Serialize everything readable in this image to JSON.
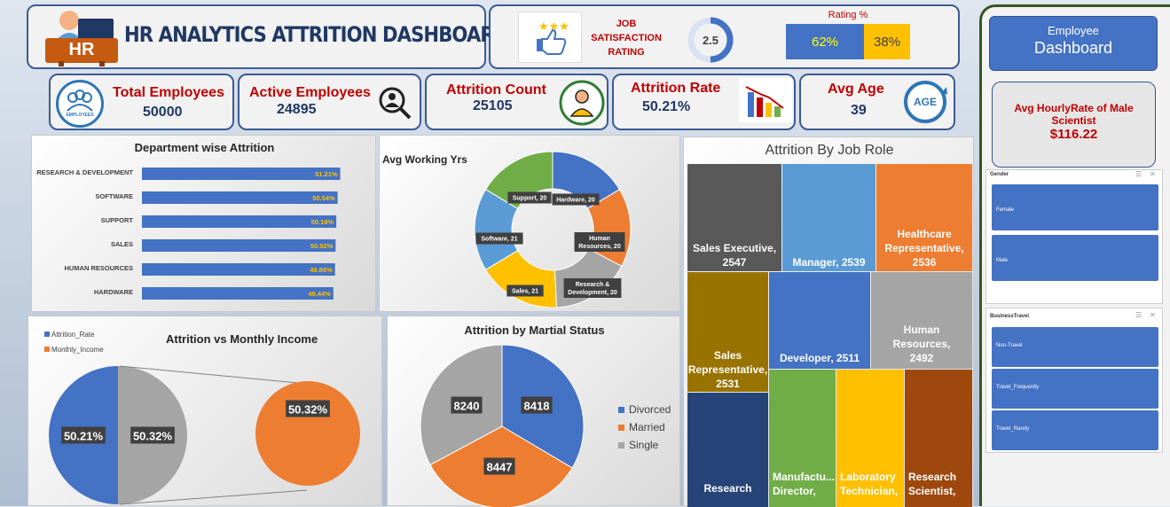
{
  "header": {
    "title": "HR ANALYTICS ATTRITION DASHBOARD",
    "logo_text": "HR"
  },
  "satisfaction": {
    "label_line1": "JOB",
    "label_line2": "SATISFACTION",
    "label_line3": "RATING",
    "value": "2.5",
    "gauge_fraction": 0.5
  },
  "rating": {
    "title": "Rating %",
    "seg1": "62%",
    "seg2": "38%",
    "seg1_fraction": 0.62,
    "seg1_color": "#4472c4",
    "seg2_color": "#ffc000"
  },
  "kpis": {
    "total_label": "Total Employees",
    "total_value": "50000",
    "total_icon_text": "EMPLOYEES",
    "active_label": "Active Employees",
    "active_value": "24895",
    "count_label": "Attrition Count",
    "count_value": "25105",
    "rate_label": "Attrition Rate",
    "rate_value": "50.21%",
    "age_label": "Avg Age",
    "age_value": "39",
    "age_icon_text": "AGE"
  },
  "sidebar": {
    "btn_line1": "Employee",
    "btn_line2": "Dashboard",
    "hourly_label": "Avg HourlyRate of Male Scientist",
    "hourly_value": "$116.22",
    "gender_title": "Gender",
    "gender_items": [
      "Female",
      "Male"
    ],
    "travel_title": "BusinessTravel",
    "travel_items": [
      "Non-Travel",
      "Travel_Frequently",
      "Travel_Rarely"
    ]
  },
  "dept_chart": {
    "title": "Department wise Attrition"
  },
  "avg_chart": {
    "title": "Avg Working Yrs"
  },
  "income_chart": {
    "title": "Attrition vs Monthly Income",
    "legend": [
      "Attrition_Rate",
      "Monthly_Income"
    ]
  },
  "marital_chart": {
    "title": "Attrition by Martial Status",
    "legend": [
      "Divorced",
      "Married",
      "Single"
    ]
  },
  "role_chart": {
    "title": "Attrition By Job Role"
  },
  "colors": {
    "blue": "#4472c4",
    "orange": "#ed7d31",
    "gray": "#a5a5a5",
    "yellow": "#ffc000",
    "navy": "#1f3864",
    "red": "#c00000",
    "green": "#70ad47"
  },
  "chart_data": [
    {
      "type": "bar",
      "title": "Department wise Attrition",
      "categories": [
        "RESEARCH & DEVELOPMENT",
        "SOFTWARE",
        "SUPPORT",
        "SALES",
        "HUMAN RESOURCES",
        "HARDWARE"
      ],
      "values": [
        51.21,
        50.54,
        50.19,
        50.02,
        49.86,
        49.44
      ],
      "labels": [
        "51.21%",
        "50.54%",
        "50.19%",
        "50.02%",
        "49.86%",
        "49.44%"
      ]
    },
    {
      "type": "pie",
      "title": "Avg Working Yrs",
      "donut": true,
      "slices": [
        {
          "label": "Hardware, 20",
          "value": 20,
          "color": "#4472c4"
        },
        {
          "label": "Human Resources, 20",
          "value": 20,
          "color": "#ed7d31"
        },
        {
          "label": "Research & Development, 20",
          "value": 20,
          "color": "#a5a5a5"
        },
        {
          "label": "Sales, 21",
          "value": 21,
          "color": "#ffc000"
        },
        {
          "label": "Software, 21",
          "value": 21,
          "color": "#5b9bd5"
        },
        {
          "label": "Support, 20",
          "value": 20,
          "color": "#70ad47"
        }
      ]
    },
    {
      "type": "pie",
      "title": "Attrition vs Monthly Income",
      "slices": [
        {
          "label": "50.21%",
          "value": 50.21,
          "color": "#4472c4"
        },
        {
          "label": "50.32%",
          "value": 50.32,
          "color": "#a5a5a5"
        }
      ],
      "detail_label": "50.32%"
    },
    {
      "type": "pie",
      "title": "Attrition by Martial Status",
      "slices": [
        {
          "label": "8418",
          "name": "Divorced",
          "value": 8418,
          "color": "#4472c4"
        },
        {
          "label": "8447",
          "name": "Married",
          "value": 8447,
          "color": "#ed7d31"
        },
        {
          "label": "8240",
          "name": "Single",
          "value": 8240,
          "color": "#a5a5a5"
        }
      ]
    },
    {
      "type": "treemap",
      "title": "Attrition By Job Role",
      "items": [
        {
          "role": "Sales Executive,",
          "value": "2547",
          "color": "#595959"
        },
        {
          "role": "Manager,",
          "value": "2539",
          "color": "#5b9bd5"
        },
        {
          "role": "Healthcare Representative,",
          "value": "2536",
          "color": "#ed7d31"
        },
        {
          "role": "Sales Representative,",
          "value": "2531",
          "color": "#997300"
        },
        {
          "role": "Developer,",
          "value": "2511",
          "color": "#4472c4"
        },
        {
          "role": "Human Resources,",
          "value": "2492",
          "color": "#a5a5a5"
        },
        {
          "role": "Research",
          "value": "",
          "color": "#264478"
        },
        {
          "role": "Manufactu...",
          "value": "Director,",
          "color": "#70ad47"
        },
        {
          "role": "Laboratory",
          "value": "Technician,",
          "color": "#ffc000"
        },
        {
          "role": "Research",
          "value": "Scientist,",
          "color": "#9e480e"
        }
      ]
    }
  ]
}
